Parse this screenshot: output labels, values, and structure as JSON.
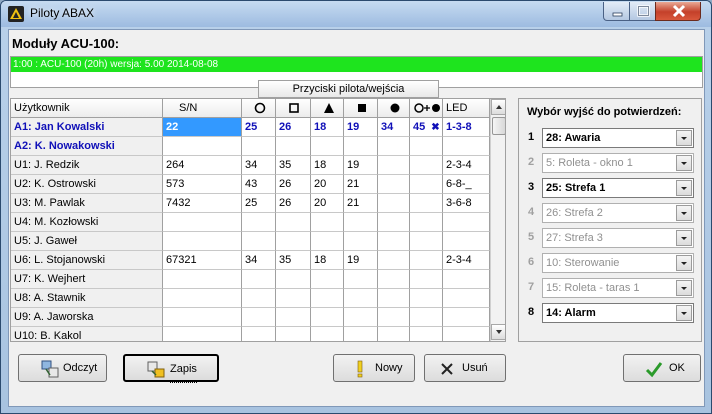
{
  "window": {
    "title": "Piloty ABAX"
  },
  "header": {
    "label": "Moduły ACU-100:"
  },
  "modules": [
    {
      "text": "1:00 : ACU-100  (20h) wersja: 5.00 2014-08-08"
    }
  ],
  "table": {
    "group_header": "Przyciski pilota/wejścia",
    "columns": {
      "user": "Użytkownik",
      "sn": "S/N",
      "led": "LED"
    },
    "rows": [
      {
        "user": "A1: Jan Kowalski",
        "sn": "22",
        "b1": "25",
        "b2": "26",
        "b3": "18",
        "b4": "19",
        "b5": "34",
        "b6": "45",
        "b6x": "✖",
        "led": "1-3-8"
      },
      {
        "user": "A2: K. Nowakowski",
        "sn": "",
        "b1": "",
        "b2": "",
        "b3": "",
        "b4": "",
        "b5": "",
        "b6": "",
        "b6x": "",
        "led": ""
      },
      {
        "user": "U1: J. Redzik",
        "sn": "264",
        "b1": "34",
        "b2": "35",
        "b3": "18",
        "b4": "19",
        "b5": "",
        "b6": "",
        "b6x": "",
        "led": "2-3-4"
      },
      {
        "user": "U2: K. Ostrowski",
        "sn": "573",
        "b1": "43",
        "b2": "26",
        "b3": "20",
        "b4": "21",
        "b5": "",
        "b6": "",
        "b6x": "",
        "led": "6-8-_"
      },
      {
        "user": "U3: M. Pawlak",
        "sn": "7432",
        "b1": "25",
        "b2": "26",
        "b3": "20",
        "b4": "21",
        "b5": "",
        "b6": "",
        "b6x": "",
        "led": "3-6-8"
      },
      {
        "user": "U4: M. Kozłowski",
        "sn": "",
        "b1": "",
        "b2": "",
        "b3": "",
        "b4": "",
        "b5": "",
        "b6": "",
        "b6x": "",
        "led": ""
      },
      {
        "user": "U5: J. Gaweł",
        "sn": "",
        "b1": "",
        "b2": "",
        "b3": "",
        "b4": "",
        "b5": "",
        "b6": "",
        "b6x": "",
        "led": ""
      },
      {
        "user": "U6: L. Stojanowski",
        "sn": "67321",
        "b1": "34",
        "b2": "35",
        "b3": "18",
        "b4": "19",
        "b5": "",
        "b6": "",
        "b6x": "",
        "led": "2-3-4"
      },
      {
        "user": "U7: K. Wejhert",
        "sn": "",
        "b1": "",
        "b2": "",
        "b3": "",
        "b4": "",
        "b5": "",
        "b6": "",
        "b6x": "",
        "led": ""
      },
      {
        "user": "U8: A. Stawnik",
        "sn": "",
        "b1": "",
        "b2": "",
        "b3": "",
        "b4": "",
        "b5": "",
        "b6": "",
        "b6x": "",
        "led": ""
      },
      {
        "user": "U9: A. Jaworska",
        "sn": "",
        "b1": "",
        "b2": "",
        "b3": "",
        "b4": "",
        "b5": "",
        "b6": "",
        "b6x": "",
        "led": ""
      },
      {
        "user": "U10: B. Kakol",
        "sn": "",
        "b1": "",
        "b2": "",
        "b3": "",
        "b4": "",
        "b5": "",
        "b6": "",
        "b6x": "",
        "led": ""
      }
    ]
  },
  "outputs": {
    "title": "Wybór wyjść do potwierdzeń:",
    "items": [
      {
        "num": "1",
        "value": "28: Awaria",
        "state": "act"
      },
      {
        "num": "2",
        "value": "5: Roleta - okno 1",
        "state": "dis"
      },
      {
        "num": "3",
        "value": "25: Strefa 1",
        "state": "act"
      },
      {
        "num": "4",
        "value": "26: Strefa 2",
        "state": "dis"
      },
      {
        "num": "5",
        "value": "27: Strefa 3",
        "state": "dis"
      },
      {
        "num": "6",
        "value": "10: Sterowanie",
        "state": "dis"
      },
      {
        "num": "7",
        "value": "15: Roleta - taras 1",
        "state": "dis"
      },
      {
        "num": "8",
        "value": "14: Alarm",
        "state": "act"
      }
    ]
  },
  "buttons": {
    "read": "Odczyt",
    "write": "Zapis",
    "new": "Nowy",
    "delete": "Usuń",
    "ok": "OK"
  },
  "colors": {
    "module_row": "#1ee41e",
    "selection": "#3399ff",
    "bold_row": "#1010b8"
  }
}
